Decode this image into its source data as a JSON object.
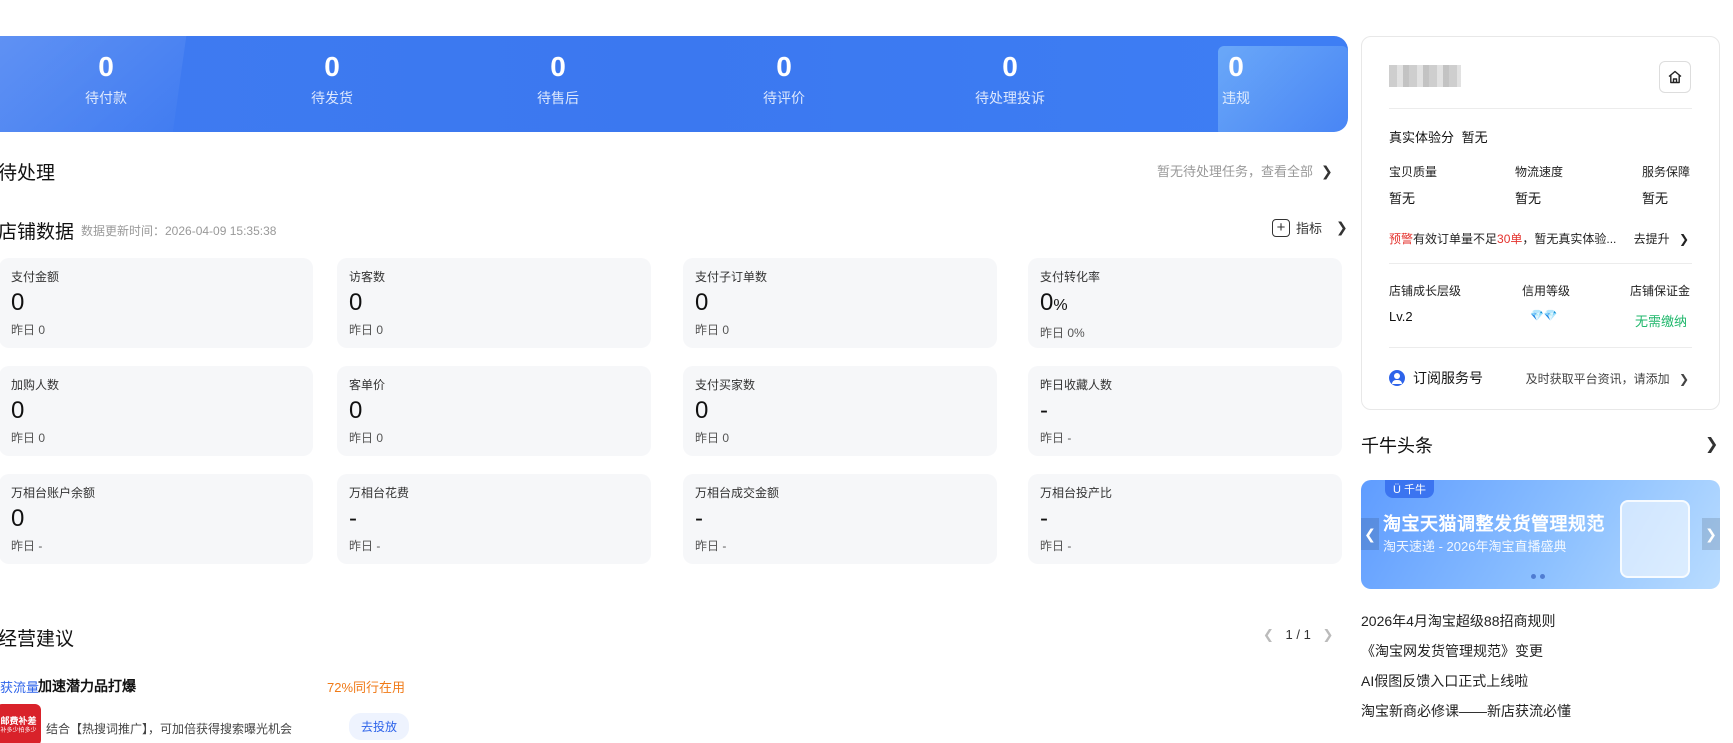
{
  "stats": [
    {
      "value": "0",
      "label": "待付款"
    },
    {
      "value": "0",
      "label": "待发货"
    },
    {
      "value": "0",
      "label": "待售后"
    },
    {
      "value": "0",
      "label": "待评价"
    },
    {
      "value": "0",
      "label": "待处理投诉"
    },
    {
      "value": "0",
      "label": "违规"
    }
  ],
  "pending": {
    "title": "待处理",
    "link": "暂无待处理任务，查看全部"
  },
  "shop_data": {
    "title": "店铺数据",
    "updated": "数据更新时间：2026-04-09 15:35:38",
    "metric_label": "指标",
    "cards": [
      {
        "label": "支付金额",
        "value": "0",
        "yesterday": "昨日 0"
      },
      {
        "label": "访客数",
        "value": "0",
        "yesterday": "昨日 0"
      },
      {
        "label": "支付子订单数",
        "value": "0",
        "yesterday": "昨日 0"
      },
      {
        "label": "支付转化率",
        "value": "0",
        "unit": "%",
        "yesterday": "昨日 0%"
      },
      {
        "label": "加购人数",
        "value": "0",
        "yesterday": "昨日 0"
      },
      {
        "label": "客单价",
        "value": "0",
        "yesterday": "昨日 0"
      },
      {
        "label": "支付买家数",
        "value": "0",
        "yesterday": "昨日 0"
      },
      {
        "label": "昨日收藏人数",
        "value": "-",
        "yesterday": "昨日 -"
      },
      {
        "label": "万相台账户余额",
        "value": "0",
        "yesterday": "昨日 -"
      },
      {
        "label": "万相台花费",
        "value": "-",
        "yesterday": "昨日 -"
      },
      {
        "label": "万相台成交金额",
        "value": "-",
        "yesterday": "昨日 -"
      },
      {
        "label": "万相台投产比",
        "value": "-",
        "yesterday": "昨日 -"
      }
    ]
  },
  "advice": {
    "title": "经营建议",
    "pager": "1 / 1",
    "tag": "获流量",
    "item_title": "加速潜力品打爆",
    "peer": "72%同行在用",
    "thumb_text": "邮费补差",
    "thumb_sub": "补多少拍多少",
    "desc": "结合【热搜词推广】，可加倍获得搜索曝光机会",
    "button": "去投放"
  },
  "panel": {
    "experience_label": "真实体验分",
    "experience_value": "暂无",
    "scores": [
      {
        "label": "宝贝质量",
        "value": "暂无"
      },
      {
        "label": "物流速度",
        "value": "暂无"
      },
      {
        "label": "服务保障",
        "value": "暂无"
      }
    ],
    "warn_tag": "预警",
    "warn_text_a": "有效订单量不足",
    "warn_num": "30单",
    "warn_text_b": "，暂无真实体验...",
    "warn_action": "去提升",
    "levels": [
      {
        "label": "店铺成长层级",
        "value": "Lv.2"
      },
      {
        "label": "信用等级",
        "value": "💎💎"
      },
      {
        "label": "店铺保证金",
        "value": "无需缴纳"
      }
    ],
    "subscribe_label": "订阅服务号",
    "subscribe_hint": "及时获取平台资讯，请添加"
  },
  "headlines": {
    "title": "千牛头条",
    "banner_tag": "千牛",
    "banner_title": "淘宝天猫调整发货管理规范",
    "banner_sub": "淘天速递 - 2026年淘宝直播盛典",
    "items": [
      "2026年4月淘宝超级88招商规则",
      "《淘宝网发货管理规范》变更",
      "AI假图反馈入口正式上线啦",
      "淘宝新商必修课——新店获流必懂"
    ]
  },
  "colors": {
    "banner_blue": "#3b78f0",
    "link_blue": "#2d63ea",
    "warn_red": "#e4322d",
    "green": "#1fb76b",
    "orange": "#f07a17"
  }
}
